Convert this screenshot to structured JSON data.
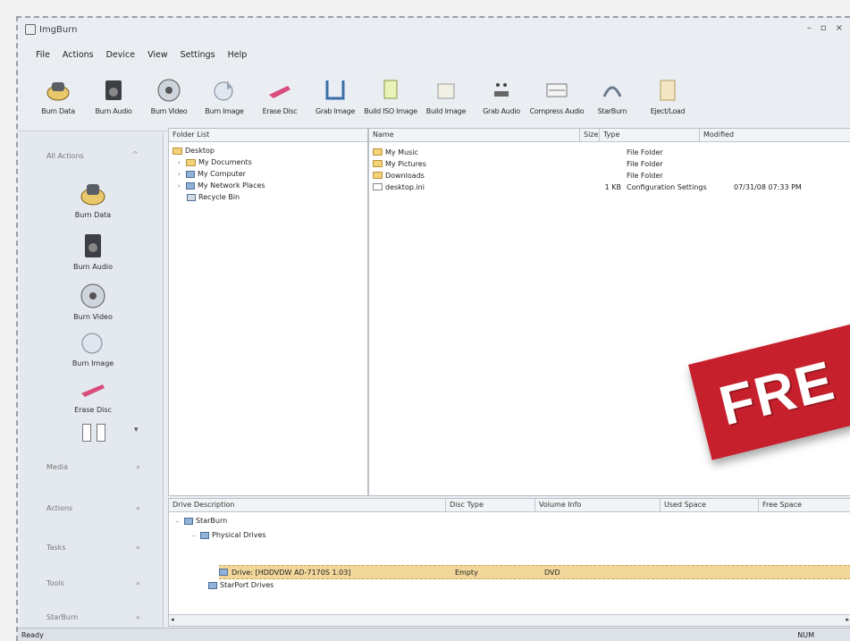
{
  "window": {
    "title": "ImgBurn",
    "controls": [
      "–",
      "▫",
      "×"
    ]
  },
  "menu": [
    "File",
    "Actions",
    "Device",
    "View",
    "Settings",
    "Help"
  ],
  "toolbar": [
    {
      "label": "Burn Data",
      "icon": "burn-data-icon"
    },
    {
      "label": "Burn Audio",
      "icon": "burn-audio-icon"
    },
    {
      "label": "Burn Video",
      "icon": "burn-video-icon"
    },
    {
      "label": "Burn Image",
      "icon": "burn-image-icon"
    },
    {
      "label": "Erase Disc",
      "icon": "erase-disc-icon"
    },
    {
      "label": "Grab Image",
      "icon": "grab-image-icon"
    },
    {
      "label": "Build ISO Image",
      "icon": "build-iso-icon"
    },
    {
      "label": "Build Image",
      "icon": "build-image-icon"
    },
    {
      "label": "Grab Audio",
      "icon": "grab-audio-icon"
    },
    {
      "label": "Compress Audio",
      "icon": "compress-audio-icon"
    },
    {
      "label": "StarBurn",
      "icon": "starburn-icon"
    },
    {
      "label": "Eject/Load",
      "icon": "eject-icon"
    }
  ],
  "sidebar": {
    "header": "All Actions",
    "items": [
      "Burn Data",
      "Burn Audio",
      "Burn Video",
      "Burn Image",
      "Erase Disc"
    ],
    "sections": [
      "Media",
      "Actions",
      "Tasks",
      "Tools",
      "StarBurn"
    ]
  },
  "folder_tree": {
    "header": "Folder List",
    "rows": [
      "Desktop",
      "My Documents",
      "My Computer",
      "My Network Places",
      "Recycle Bin"
    ]
  },
  "file_list": {
    "columns": [
      "Name",
      "Size",
      "Type",
      "Modified"
    ],
    "rows": [
      {
        "name": "My Music",
        "size": "",
        "type": "File Folder",
        "modified": ""
      },
      {
        "name": "My Pictures",
        "size": "",
        "type": "File Folder",
        "modified": ""
      },
      {
        "name": "Downloads",
        "size": "",
        "type": "File Folder",
        "modified": ""
      },
      {
        "name": "desktop.ini",
        "size": "1 KB",
        "type": "Configuration Settings",
        "modified": "07/31/08 07:33 PM"
      }
    ]
  },
  "drives": {
    "columns": [
      "Drive Description",
      "Disc Type",
      "Volume Info",
      "Used Space",
      "Free Space"
    ],
    "root": "StarBurn",
    "physical": "Physical Drives",
    "drive_row": {
      "description": "Drive: [HDDVDW AD-7170S 1.03]",
      "disc_type": "Empty",
      "volume": "DVD"
    },
    "virtual": "StarPort Drives"
  },
  "status": {
    "left": "Ready",
    "right": "NUM"
  },
  "banner": {
    "text": "FRE"
  }
}
